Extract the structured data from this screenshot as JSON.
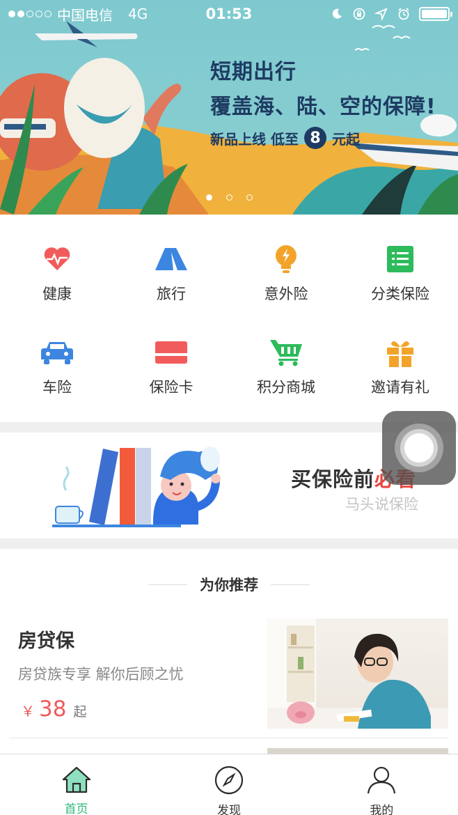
{
  "status_bar": {
    "carrier": "中国电信",
    "network": "4G",
    "time": "01:53"
  },
  "banner": {
    "title": "短期出行",
    "subtitle": "覆盖海、陆、空的保障!",
    "promo_prefix": "新品上线  低至",
    "promo_number": "8",
    "promo_suffix": "元起",
    "slide_count": 3,
    "active_slide": 0
  },
  "categories": [
    {
      "label": "健康",
      "icon": "heart-pulse-icon",
      "color": "#f25b5b"
    },
    {
      "label": "旅行",
      "icon": "tent-icon",
      "color": "#3d86e0"
    },
    {
      "label": "意外险",
      "icon": "lightbulb-icon",
      "color": "#f4a32a"
    },
    {
      "label": "分类保险",
      "icon": "list-icon",
      "color": "#2dbb5c"
    },
    {
      "label": "车险",
      "icon": "car-icon",
      "color": "#3d86e0"
    },
    {
      "label": "保险卡",
      "icon": "card-icon",
      "color": "#f25b5b"
    },
    {
      "label": "积分商城",
      "icon": "cart-icon",
      "color": "#2dbb5c"
    },
    {
      "label": "邀请有礼",
      "icon": "gift-icon",
      "color": "#f4a32a"
    }
  ],
  "promo_card": {
    "title_main": "买保险前",
    "title_accent": "必看",
    "subtitle": "马头说保险"
  },
  "recommend": {
    "heading": "为你推荐",
    "items": [
      {
        "name": "房贷保",
        "desc": "房贷族专享 解你后顾之忧",
        "currency": "￥",
        "price": "38",
        "price_suffix": "起"
      }
    ]
  },
  "tabbar": [
    {
      "label": "首页",
      "icon": "home-icon",
      "active": true
    },
    {
      "label": "发现",
      "icon": "compass-icon",
      "active": false
    },
    {
      "label": "我的",
      "icon": "user-icon",
      "active": false
    }
  ],
  "colors": {
    "accent_green": "#2db77a",
    "price_red": "#f05a5a",
    "banner_navy": "#1e3b62"
  }
}
